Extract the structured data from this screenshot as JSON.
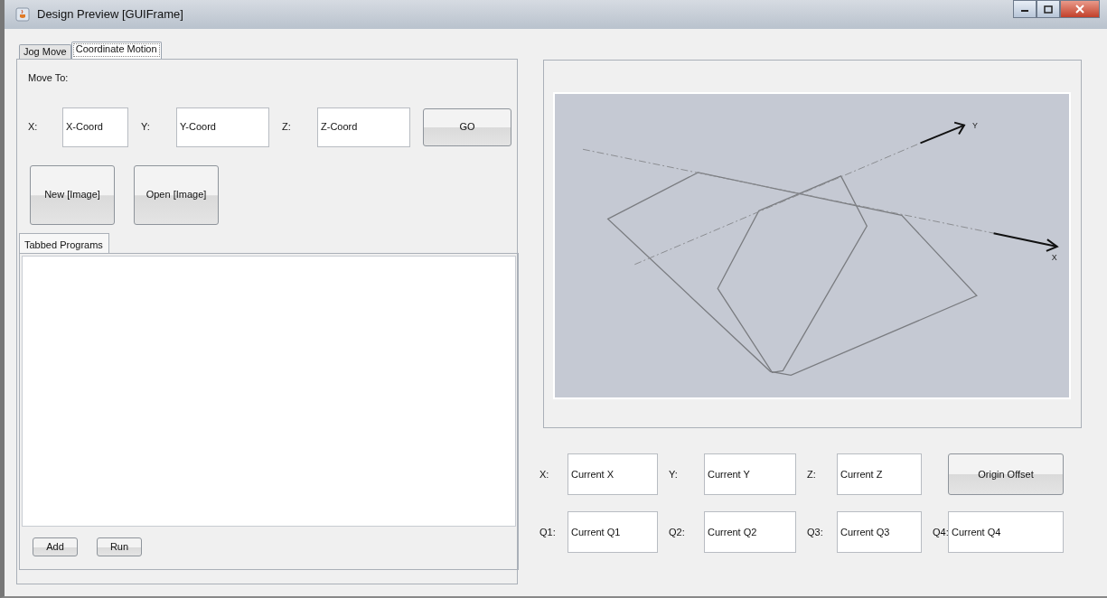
{
  "window": {
    "title": "Design Preview [GUIFrame]"
  },
  "tabs": [
    {
      "label": "Jog Move",
      "selected": false
    },
    {
      "label": "Coordinate Motion",
      "selected": true
    }
  ],
  "move_to": {
    "label": "Move To:",
    "fields": [
      {
        "label": "X:",
        "value": "X-Coord"
      },
      {
        "label": "Y:",
        "value": "Y-Coord"
      },
      {
        "label": "Z:",
        "value": "Z-Coord"
      }
    ],
    "go_button": "GO"
  },
  "image_buttons": [
    "New [Image]",
    "Open [Image]"
  ],
  "programs": {
    "tabs": [
      {
        "label": "Tabbed Programs",
        "selected": true
      }
    ],
    "buttons": [
      "Add",
      "Run"
    ]
  },
  "preview": {
    "axes": [
      {
        "label": "X"
      },
      {
        "label": "Y"
      }
    ]
  },
  "current": {
    "rows": [
      [
        {
          "kind": "field",
          "label": "X:",
          "value": "Current X"
        },
        {
          "kind": "field",
          "label": "Y:",
          "value": "Current Y"
        },
        {
          "kind": "field",
          "label": "Z:",
          "value": "Current Z"
        },
        {
          "kind": "button",
          "label": "Origin Offset"
        }
      ],
      [
        {
          "kind": "field",
          "label": "Q1:",
          "value": "Current Q1"
        },
        {
          "kind": "field",
          "label": "Q2:",
          "value": "Current Q2"
        },
        {
          "kind": "field",
          "label": "Q3:",
          "value": "Current Q3"
        },
        {
          "kind": "field",
          "label": "Q4:",
          "value": "Current Q4"
        }
      ]
    ]
  }
}
